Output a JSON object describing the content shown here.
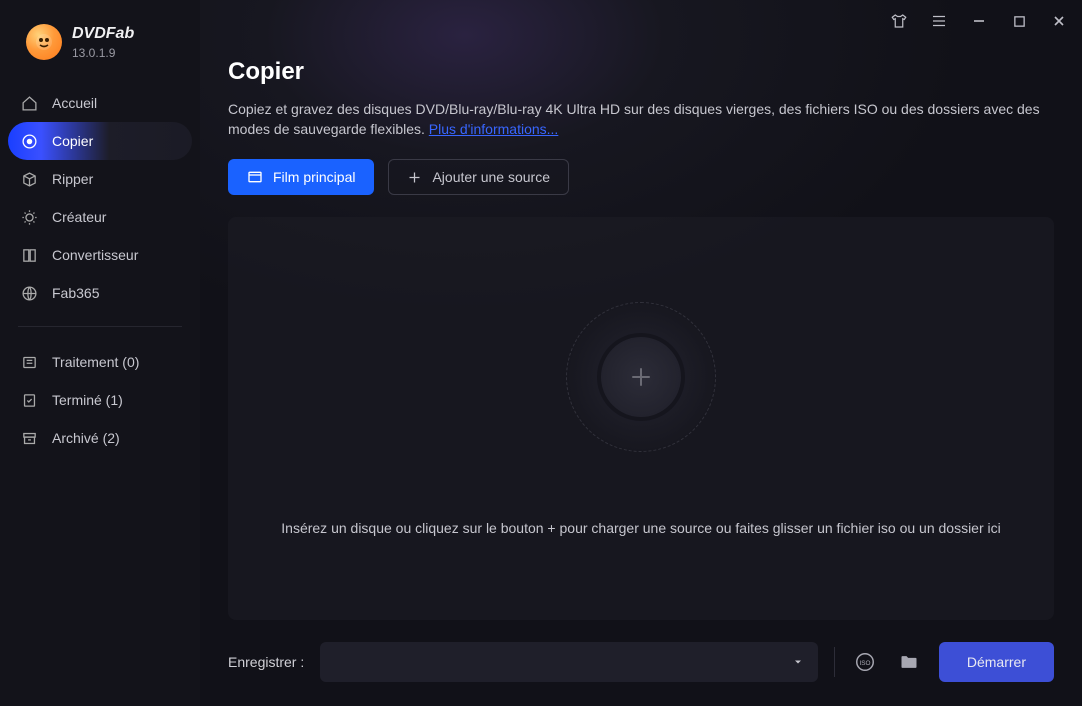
{
  "app": {
    "name": "DVDFab",
    "version": "13.0.1.9"
  },
  "sidebar": {
    "items": [
      {
        "label": "Accueil",
        "icon": "home-icon"
      },
      {
        "label": "Copier",
        "icon": "disc-icon"
      },
      {
        "label": "Ripper",
        "icon": "box-icon"
      },
      {
        "label": "Créateur",
        "icon": "sun-icon"
      },
      {
        "label": "Convertisseur",
        "icon": "convert-icon"
      },
      {
        "label": "Fab365",
        "icon": "globe-icon"
      }
    ],
    "status": [
      {
        "label": "Traitement (0)"
      },
      {
        "label": "Terminé (1)"
      },
      {
        "label": "Archivé (2)"
      }
    ]
  },
  "main": {
    "title": "Copier",
    "description_a": "Copiez et gravez des disques DVD/Blu-ray/Blu-ray 4K Ultra HD sur des disques vierges, des fichiers ISO ou des dossiers avec des modes de sauvegarde flexibles. ",
    "more_info": "Plus d'informations...",
    "buttons": {
      "primary": "Film principal",
      "add_source": "Ajouter une source"
    },
    "dropzone_text": "Insérez un disque ou cliquez sur le bouton +  pour charger une source ou faites glisser un fichier iso ou un dossier ici"
  },
  "footer": {
    "save_label": "Enregistrer :",
    "start": "Démarrer"
  }
}
